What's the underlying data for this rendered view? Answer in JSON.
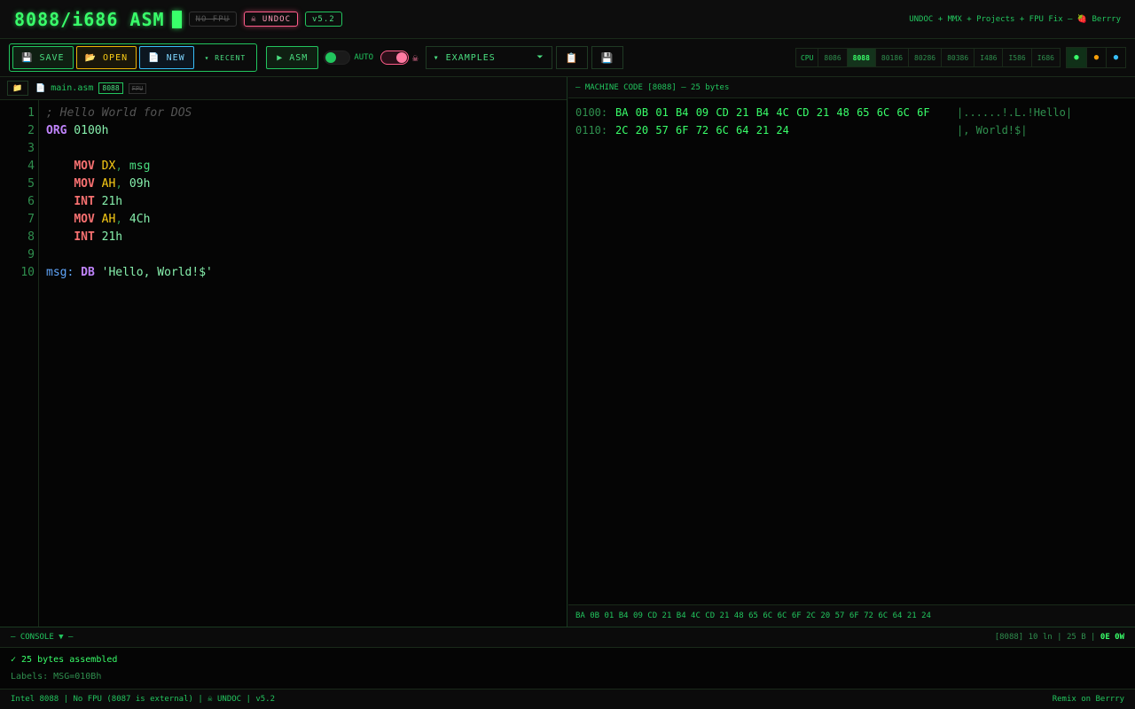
{
  "header": {
    "title": "8088/i686 ASM",
    "badge_nofpu": "NO FPU",
    "badge_undoc": "☠ UNDOC",
    "version": "v5.2",
    "credits": "UNDOC + MMX + Projects + FPU Fix — 🍓 Berrry"
  },
  "toolbar": {
    "save_label": "💾 SAVE",
    "open_label": "📂 OPEN",
    "new_label": "📄 NEW",
    "recent_label": "▾ RECENT",
    "asm_label": "▶ ASM",
    "auto_label": "AUTO",
    "undoc_icon": "☠",
    "examples_label": "▾ EXAMPLES",
    "examples_caret": "⏷",
    "copy_icon": "📋",
    "export_icon": "💾",
    "cpu_label": "CPU",
    "cpus": [
      "8086",
      "8088",
      "80186",
      "80286",
      "80386",
      "I486",
      "I586",
      "I686"
    ],
    "active_cpu": "8088",
    "theme_dots": [
      "●",
      "●",
      "●"
    ]
  },
  "editor": {
    "folder_icon": "📁",
    "file_icon": "📄",
    "file_name": "main.asm",
    "cpu_tag": "8088",
    "fpu_tag": "FPU",
    "line_numbers": [
      "1",
      "2",
      "3",
      "4",
      "5",
      "6",
      "7",
      "8",
      "9",
      "10"
    ],
    "lines": {
      "l1_comment": "; Hello World for DOS",
      "l2_dir": "ORG",
      "l2_num": " 0100h",
      "l4_op": "MOV",
      "l4_reg": " DX",
      "l4_punc": ",",
      "l4_ident": " msg",
      "l5_op": "MOV",
      "l5_reg": " AH",
      "l5_punc": ",",
      "l5_num": " 09h",
      "l6_op": "INT",
      "l6_num": " 21h",
      "l7_op": "MOV",
      "l7_reg": " AH",
      "l7_punc": ",",
      "l7_num": " 4Ch",
      "l8_op": "INT",
      "l8_num": " 21h",
      "l10_label": "msg:",
      "l10_dir": " DB",
      "l10_str": " 'Hello, World!$'"
    }
  },
  "machine": {
    "header": "— MACHINE CODE [8088] — 25 bytes",
    "rows": [
      {
        "addr": "0100:",
        "bytes": "BA 0B 01 B4 09 CD 21 B4 4C CD 21 48 65 6C 6C 6F",
        "ascii": "|......!.L.!Hello|"
      },
      {
        "addr": "0110:",
        "bytes": "2C 20 57 6F 72 6C 64 21 24",
        "ascii": "|, World!$|"
      }
    ],
    "footer": "BA 0B 01 B4 09 CD 21 B4 4C CD 21 48 65 6C 6C 6F 2C 20 57 6F 72 6C 64 21 24"
  },
  "console": {
    "header": "— CONSOLE ▼ —",
    "stats": "[8088] 10 ln | 25 B |",
    "stats_hl": "0E 0W",
    "line1": "✓ 25 bytes assembled",
    "line2": "Labels: MSG=010Bh"
  },
  "status": {
    "left": "Intel 8088 | No FPU (8087 is external) | ☠ UNDOC | v5.2",
    "right": "Remix on Berrry"
  }
}
